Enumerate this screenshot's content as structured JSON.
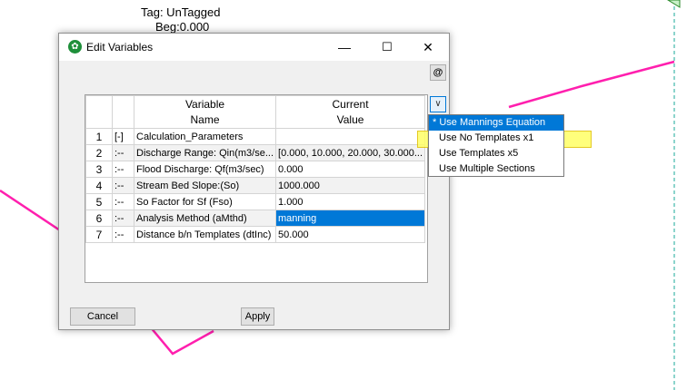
{
  "canvas": {
    "tag_label": "Tag: UnTagged",
    "beg_label": "Beg:0.000"
  },
  "colors": {
    "profile_line": "#ff1fae",
    "guide_line": "#18a89a",
    "selection": "#0078d7",
    "highlight": "#ffff66"
  },
  "dialog": {
    "title": "Edit Variables",
    "app_icon": "app-leaf-icon",
    "minimize_glyph": "—",
    "maximize_glyph": "☐",
    "close_glyph": "✕",
    "at_button": "@",
    "dropdown_glyph": "∨",
    "cancel_label": "Cancel",
    "apply_label": "Apply"
  },
  "grid": {
    "headers": {
      "variable_line1": "Variable",
      "variable_line2": "Name",
      "value_line1": "Current",
      "value_line2": "Value"
    },
    "rows": [
      {
        "num": "1",
        "prefix": "[-]",
        "name": "Calculation_Parameters",
        "value": ""
      },
      {
        "num": "2",
        "prefix": ":--",
        "name": "Discharge Range: Qin(m3/se...",
        "value": "[0.000, 10.000, 20.000, 30.000..."
      },
      {
        "num": "3",
        "prefix": ":--",
        "name": "Flood Discharge: Qf(m3/sec)",
        "value": "0.000"
      },
      {
        "num": "4",
        "prefix": ":--",
        "name": "Stream Bed Slope:(So)",
        "value": "1000.000"
      },
      {
        "num": "5",
        "prefix": ":--",
        "name": "So Factor for Sf (Fso)",
        "value": "1.000"
      },
      {
        "num": "6",
        "prefix": ":--",
        "name": "Analysis Method (aMthd)",
        "value": "manning"
      },
      {
        "num": "7",
        "prefix": ":--",
        "name": "Distance b/n Templates (dtInc)",
        "value": "50.000"
      }
    ]
  },
  "dropdown": {
    "options": [
      "* Use Mannings Equation",
      "Use No Templates x1",
      "Use Templates x5",
      "Use Multiple Sections"
    ]
  }
}
